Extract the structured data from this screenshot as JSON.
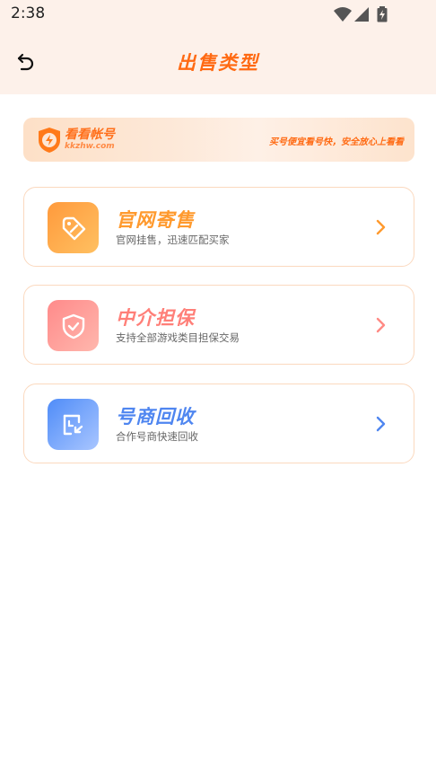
{
  "status_bar": {
    "time": "2:38"
  },
  "header": {
    "title": "出售类型"
  },
  "banner": {
    "brand": "看看帐号",
    "domain": "kkzhw.com",
    "slogan": "买号便宜看号快，安全放心上看看"
  },
  "options": [
    {
      "title": "官网寄售",
      "desc": "官网挂售，迅速匹配买家",
      "icon": "price-tag-icon",
      "color": "#ff9a2e"
    },
    {
      "title": "中介担保",
      "desc": "支持全部游戏类目担保交易",
      "icon": "shield-check-icon",
      "color": "#ff7f78"
    },
    {
      "title": "号商回收",
      "desc": "合作号商快速回收",
      "icon": "recycle-icon",
      "color": "#4f86f0"
    }
  ]
}
